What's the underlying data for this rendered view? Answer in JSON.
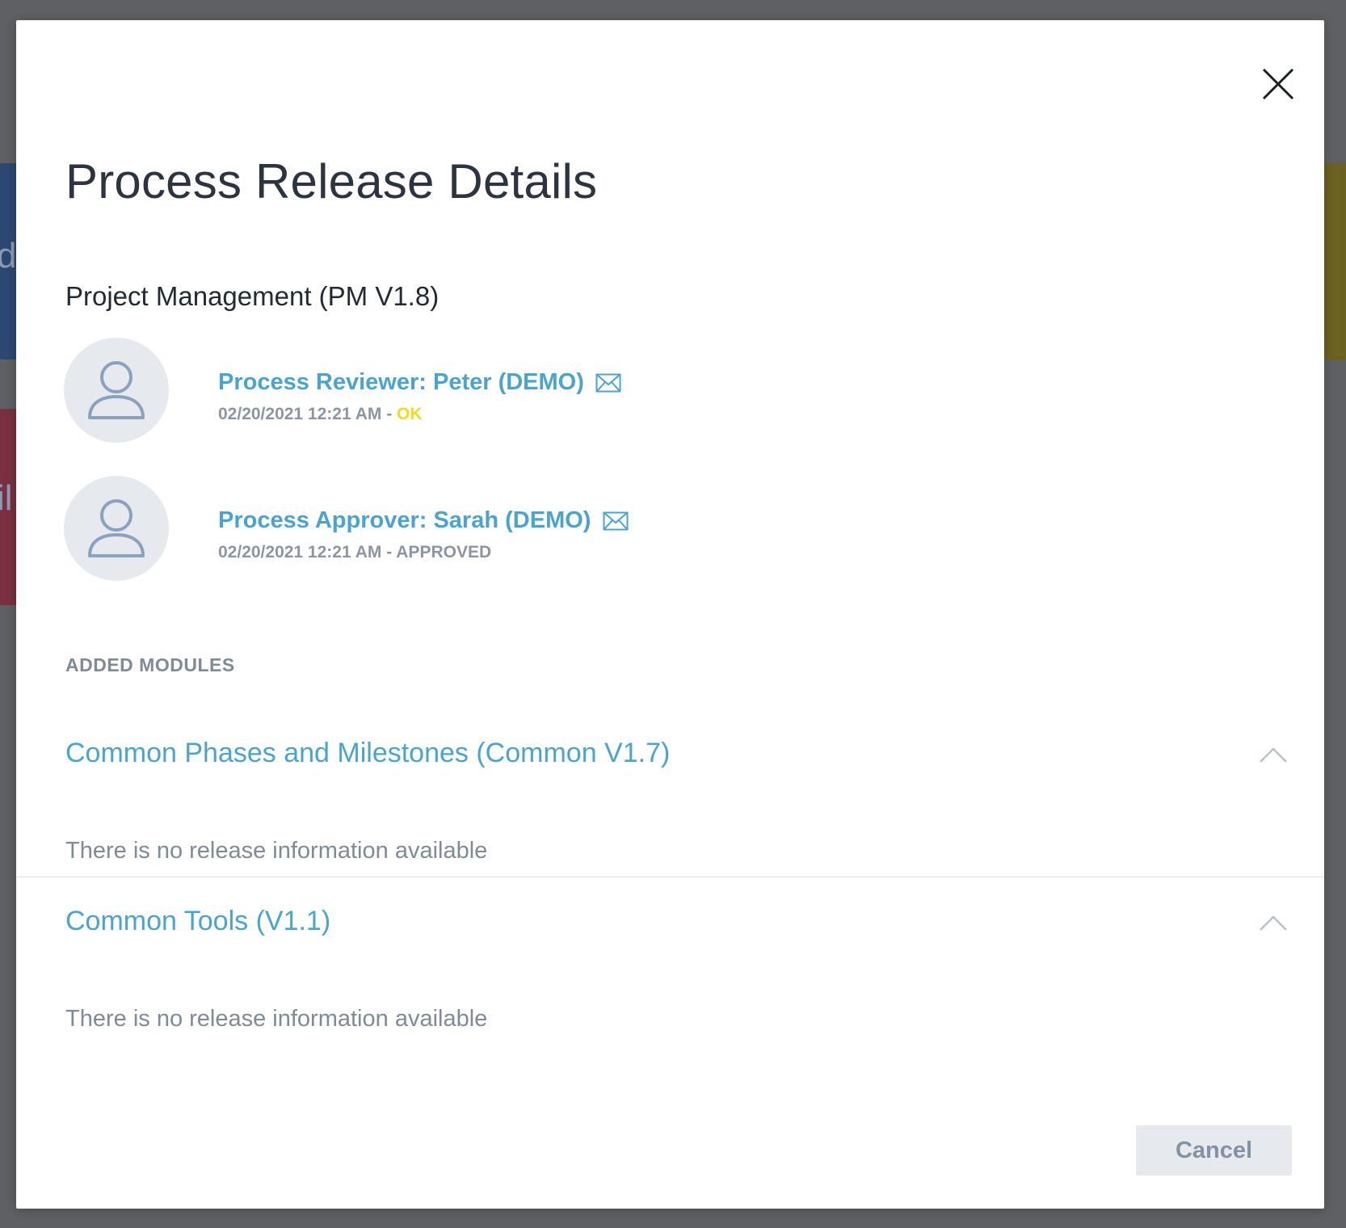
{
  "background": {
    "fragment_1": "d",
    "fragment_2": "il"
  },
  "dialog": {
    "title": "Process Release Details",
    "subtitle": "Project Management (PM V1.8)",
    "people": [
      {
        "name": "Process Reviewer: Peter (DEMO)",
        "datetime": "02/20/2021 12:21 AM",
        "separator": " - ",
        "status": "OK",
        "status_color": "#f0dc1e",
        "icon": "mail-icon"
      },
      {
        "name": "Process Approver: Sarah (DEMO)",
        "datetime": "02/20/2021 12:21 AM",
        "separator": " - ",
        "status": "APPROVED",
        "status_color": "#8c96a3",
        "icon": "mail-icon"
      }
    ],
    "modules_label": "ADDED MODULES",
    "modules": [
      {
        "title": "Common Phases and Milestones (Common V1.7)",
        "info": "There is no release information available",
        "expanded": true
      },
      {
        "title": "Common Tools (V1.1)",
        "info": "There is no release information available",
        "expanded": true
      }
    ],
    "cancel_label": "Cancel"
  },
  "colors": {
    "accent": "#4aa4cf",
    "title": "#2c3440",
    "muted": "#7f8b99",
    "ok": "#f0dc1e",
    "overlay": "#5f6063"
  }
}
